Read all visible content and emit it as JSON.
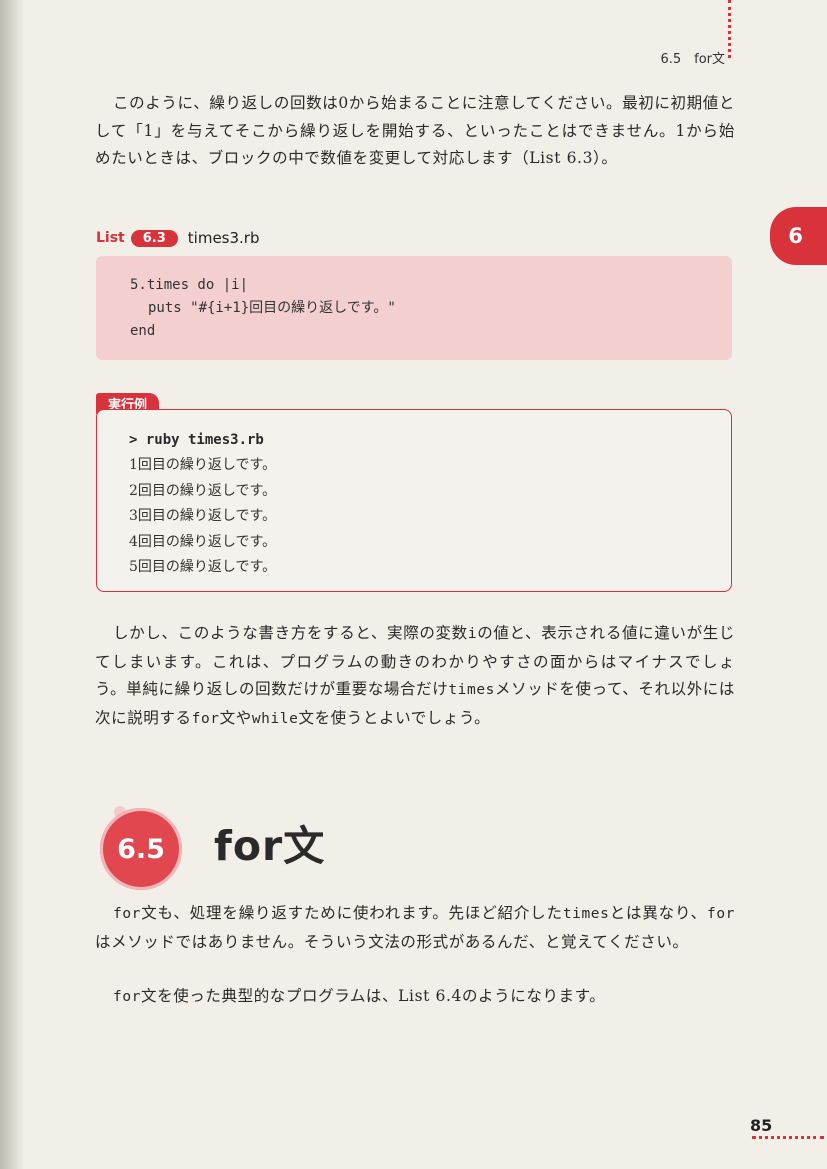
{
  "header": {
    "running_title": "6.5　for文",
    "chapter_tab": "6"
  },
  "paragraphs": {
    "intro": "このように、繰り返しの回数は0から始まることに注意してください。最初に初期値として「1」を与えてそこから繰り返しを開始する、といったことはできません。1から始めたいときは、ブロックの中で数値を変更して対応します（List 6.3）。"
  },
  "list63": {
    "label": "List",
    "number": "6.3",
    "filename": "times3.rb",
    "code": [
      "5.times do |i|",
      "puts \"#{i+1}回目の繰り返しです。\"",
      "end"
    ]
  },
  "run_example": {
    "tag": "実行例",
    "command": "> ruby times3.rb",
    "output": [
      "1回目の繰り返しです。",
      "2回目の繰り返しです。",
      "3回目の繰り返しです。",
      "4回目の繰り返しです。",
      "5回目の繰り返しです。"
    ]
  },
  "paragraph2": {
    "p1": "しかし、このような書き方をすると、実際の変数",
    "var_i": "i",
    "p2": "の値と、表示される値に違いが生じてしまいます。これは、プログラムの動きのわかりやすさの面からはマイナスでしょう。単純に繰り返しの回数だけが重要な場合だけ",
    "times": "times",
    "p3": "メソッドを使って、それ以外には次に説明する",
    "for": "for",
    "p4": "文や",
    "while": "while",
    "p5": "文を使うとよいでしょう。"
  },
  "section": {
    "number": "6.5",
    "title": "for文"
  },
  "paragraph3": {
    "for1": "for",
    "p1": "文も、処理を繰り返すために使われます。先ほど紹介した",
    "times": "times",
    "p2": "とは異なり、",
    "for2": "for",
    "p3": "はメソッドではありません。そういう文法の形式があるんだ、と覚えてください。"
  },
  "paragraph4": {
    "for": "for",
    "p1": "文を使った典型的なプログラムは、List 6.4のようになります。"
  },
  "footer": {
    "page_number": "85"
  }
}
